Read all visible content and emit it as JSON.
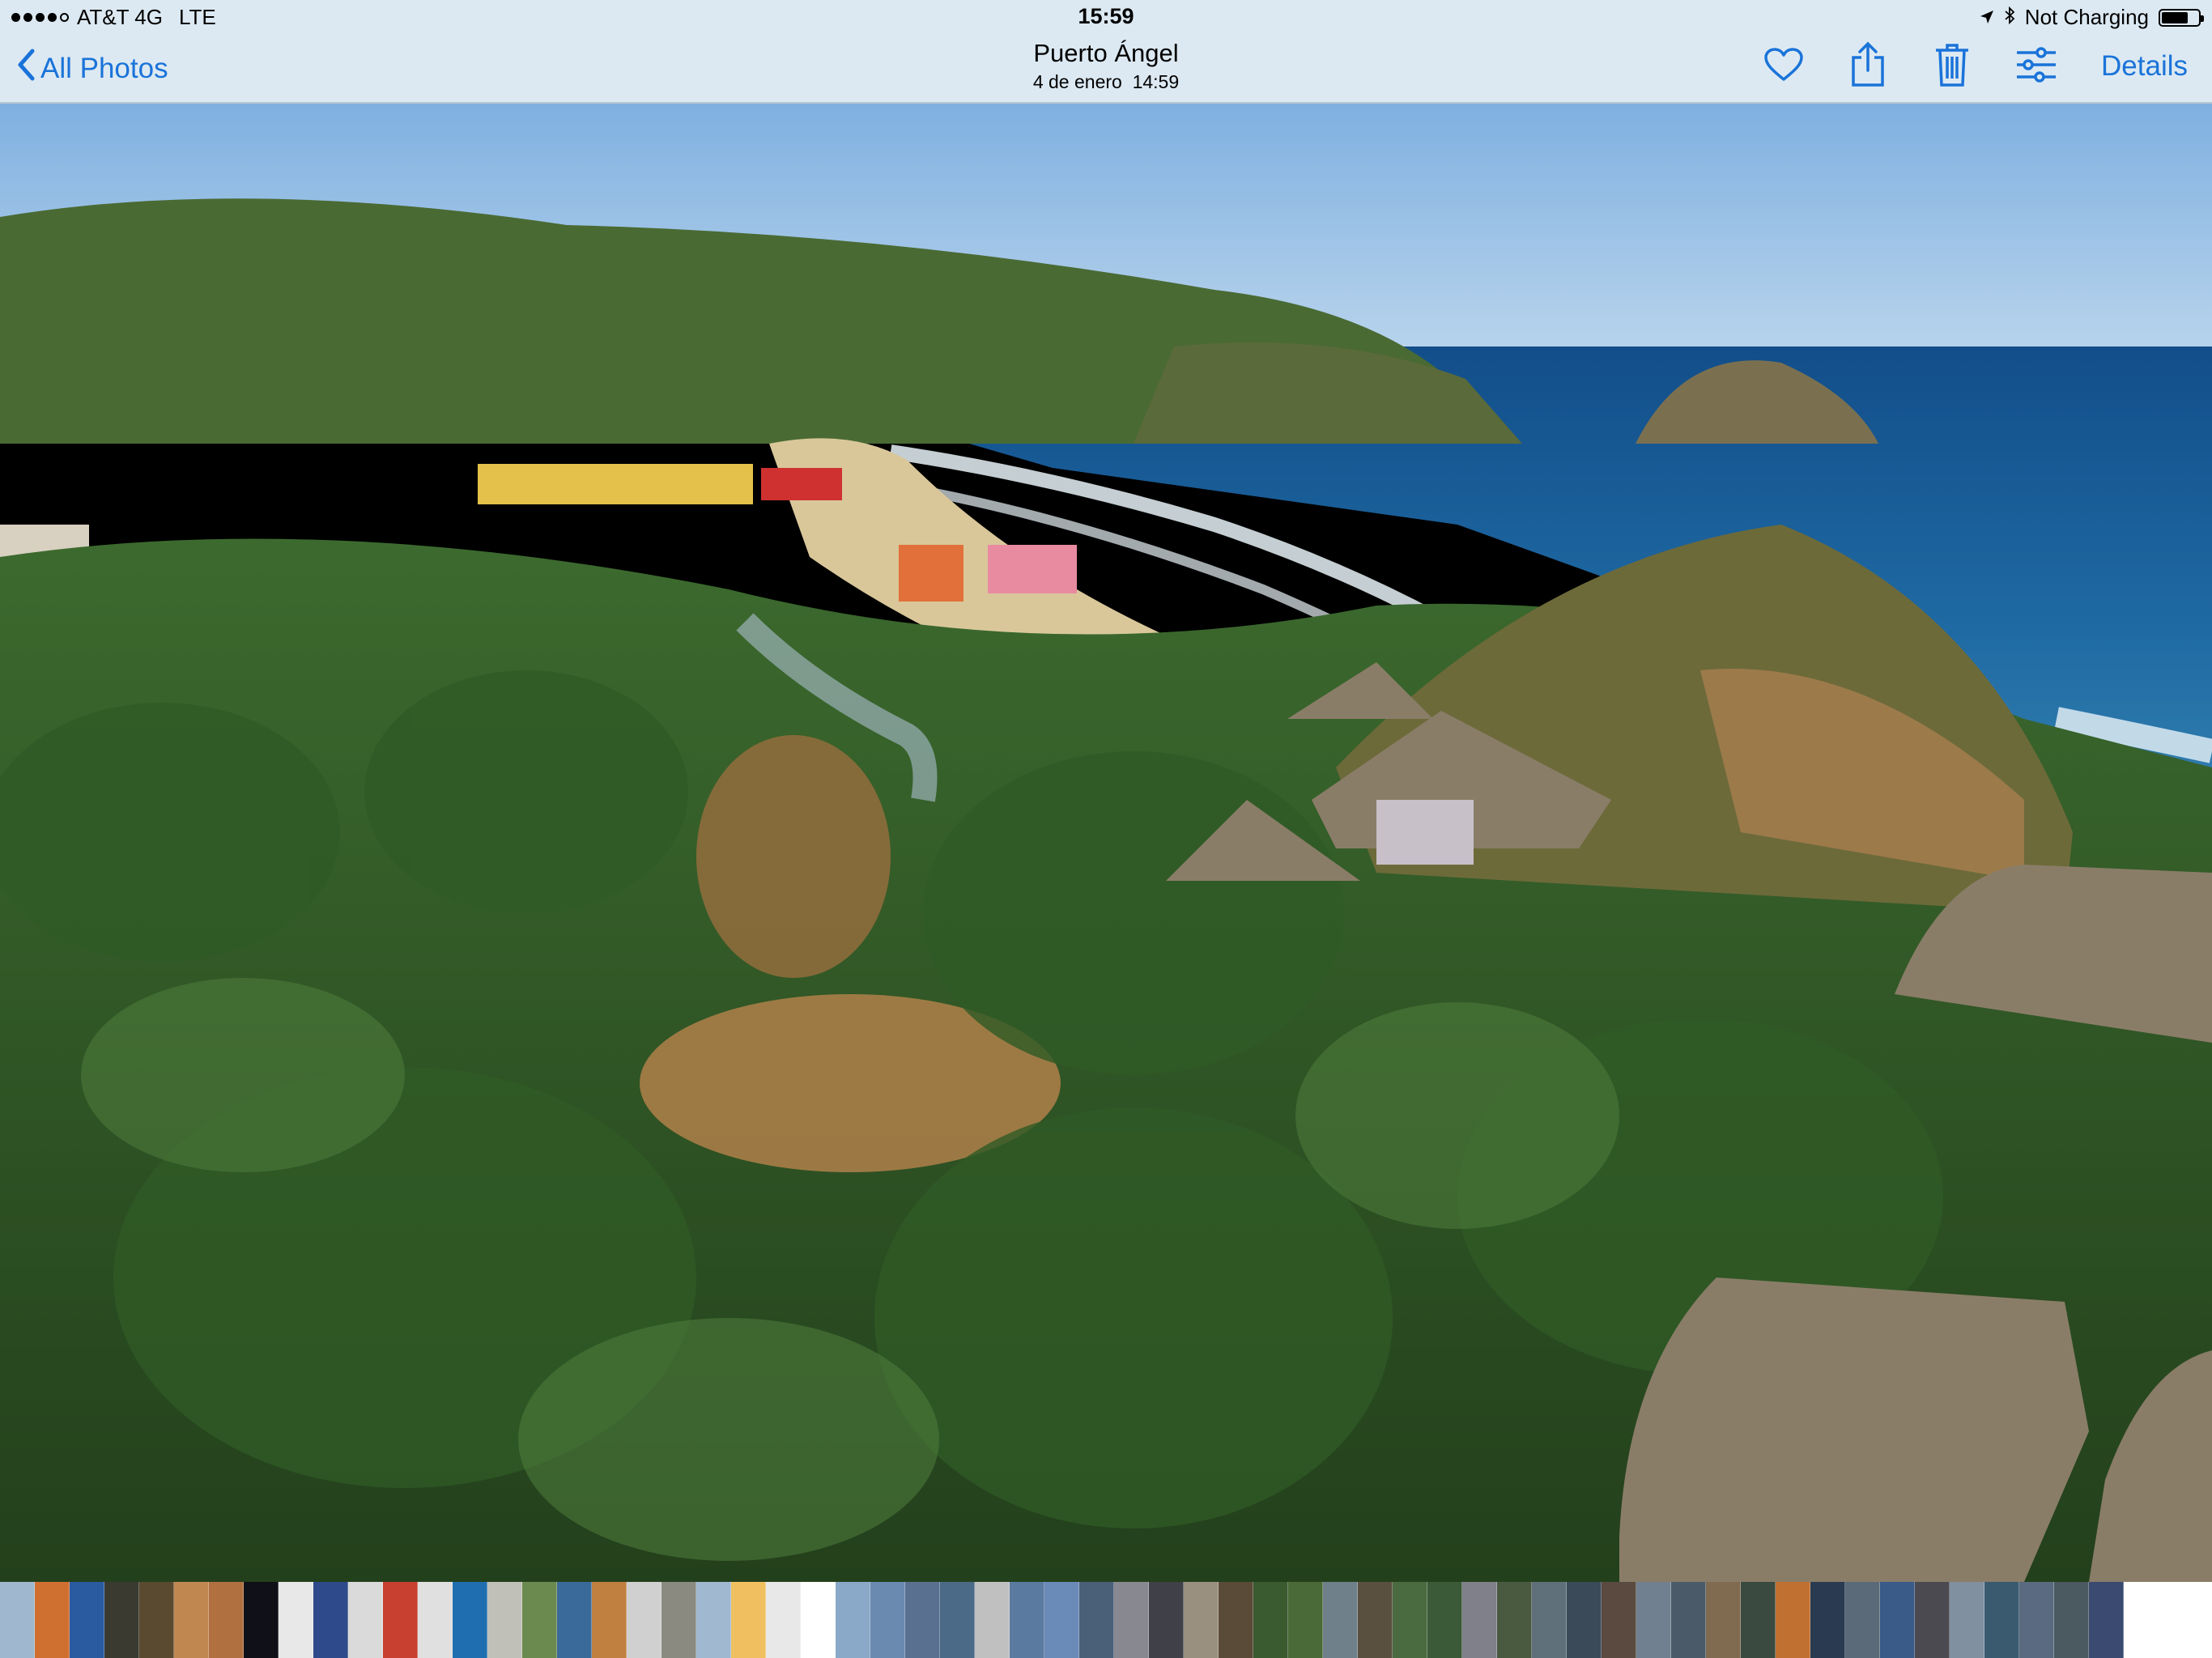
{
  "status_bar": {
    "carrier": "AT&T 4G",
    "network": "LTE",
    "time": "15:59",
    "charging": "Not Charging",
    "battery_level": 0.72,
    "signal_bars": 4
  },
  "nav": {
    "back_label": "All Photos",
    "title": "Puerto Ángel",
    "subtitle": "4 de enero  14:59",
    "details_label": "Details",
    "accent": "#1a73d9",
    "icons": [
      "heart-icon",
      "share-icon",
      "trash-icon",
      "edit-adjust-icon"
    ]
  },
  "photo": {
    "description_colors": {
      "sky": "#8fbde6",
      "sea": "#1c5f9a",
      "foliage": "#3f6a2c",
      "thatch": "#8a7d68"
    }
  },
  "filmstrip": {
    "thumbnails": [
      "#9fb7cf",
      "#d07030",
      "#2a5aa0",
      "#3a3a30",
      "#5a4a30",
      "#c08850",
      "#b07040",
      "#101018",
      "#e8e8e8",
      "#2f4a8a",
      "#dadada",
      "#c84030",
      "#e0e0e0",
      "#1f6fb0",
      "#c0c0b8",
      "#6a8a50",
      "#3a6a9a",
      "#c08040",
      "#d0d0d0",
      "#8a8a80",
      "#a0b8d0",
      "#f0c060",
      "#e8e8e8",
      "#ffffff",
      "#8aa8c8",
      "#6a8ab0",
      "#5a7090",
      "#4a6a88",
      "#c0c0c0",
      "#5a7aa0",
      "#6a8ab8",
      "#4a6078",
      "#888890",
      "#404048",
      "#9a9080",
      "#5a4a38",
      "#3a5a30",
      "#4a6a38",
      "#70808a",
      "#5a5040",
      "#4a6a40",
      "#3a5a38",
      "#80808a",
      "#4a5a40",
      "#60707a",
      "#3a4a58",
      "#5a4a40",
      "#708090",
      "#4a5a68",
      "#806a50",
      "#3a4a40",
      "#c07030",
      "#2a3a50",
      "#5a6a78",
      "#3a5a88",
      "#4a4a50",
      "#8090a0",
      "#3a5a70",
      "#5a6a80",
      "#4a5a60",
      "#3a4a70"
    ]
  }
}
